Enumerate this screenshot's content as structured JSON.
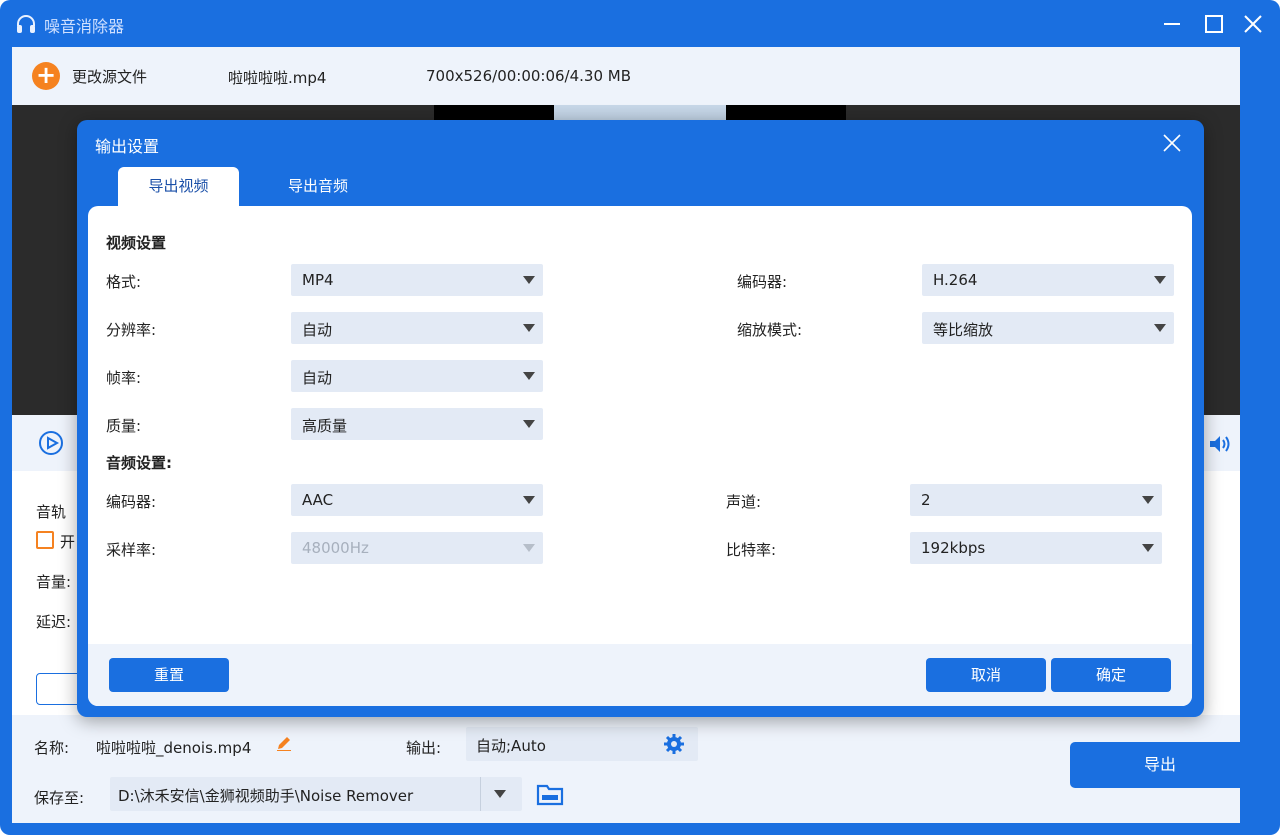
{
  "app": {
    "title": "噪音消除器"
  },
  "topbar": {
    "add_label": "更改源文件",
    "file_name": "啦啦啦啦.mp4",
    "file_info": "700x526/00:00:06/4.30 MB"
  },
  "left_panel": {
    "track_label": "音轨",
    "enable_label": "开",
    "volume_label": "音量:",
    "delay_label": "延迟:"
  },
  "bottom": {
    "name_label": "名称:",
    "name_value": "啦啦啦啦_denois.mp4",
    "output_label": "输出:",
    "output_value": "自动;Auto",
    "save_label": "保存至:",
    "save_path": "D:\\沐禾安信\\金狮视频助手\\Noise Remover",
    "export_label": "导出"
  },
  "modal": {
    "title": "输出设置",
    "tabs": [
      {
        "label": "导出视频",
        "active": true
      },
      {
        "label": "导出音频",
        "active": false
      }
    ],
    "video_section": "视频设置",
    "video_fields": {
      "format_label": "格式:",
      "format_value": "MP4",
      "encoder_label": "编码器:",
      "encoder_value": "H.264",
      "resolution_label": "分辨率:",
      "resolution_value": "自动",
      "zoom_label": "缩放模式:",
      "zoom_value": "等比缩放",
      "framerate_label": "帧率:",
      "framerate_value": "自动",
      "quality_label": "质量:",
      "quality_value": "高质量"
    },
    "audio_section": "音频设置:",
    "audio_fields": {
      "encoder_label": "编码器:",
      "encoder_value": "AAC",
      "channel_label": "声道:",
      "channel_value": "2",
      "samplerate_label": "采样率:",
      "samplerate_value": "48000Hz",
      "bitrate_label": "比特率:",
      "bitrate_value": "192kbps"
    },
    "reset_label": "重置",
    "cancel_label": "取消",
    "ok_label": "确定"
  },
  "colors": {
    "accent": "#1a6fe0",
    "orange": "#f58220",
    "panel": "#eef3fb",
    "field": "#e3eaf5"
  }
}
